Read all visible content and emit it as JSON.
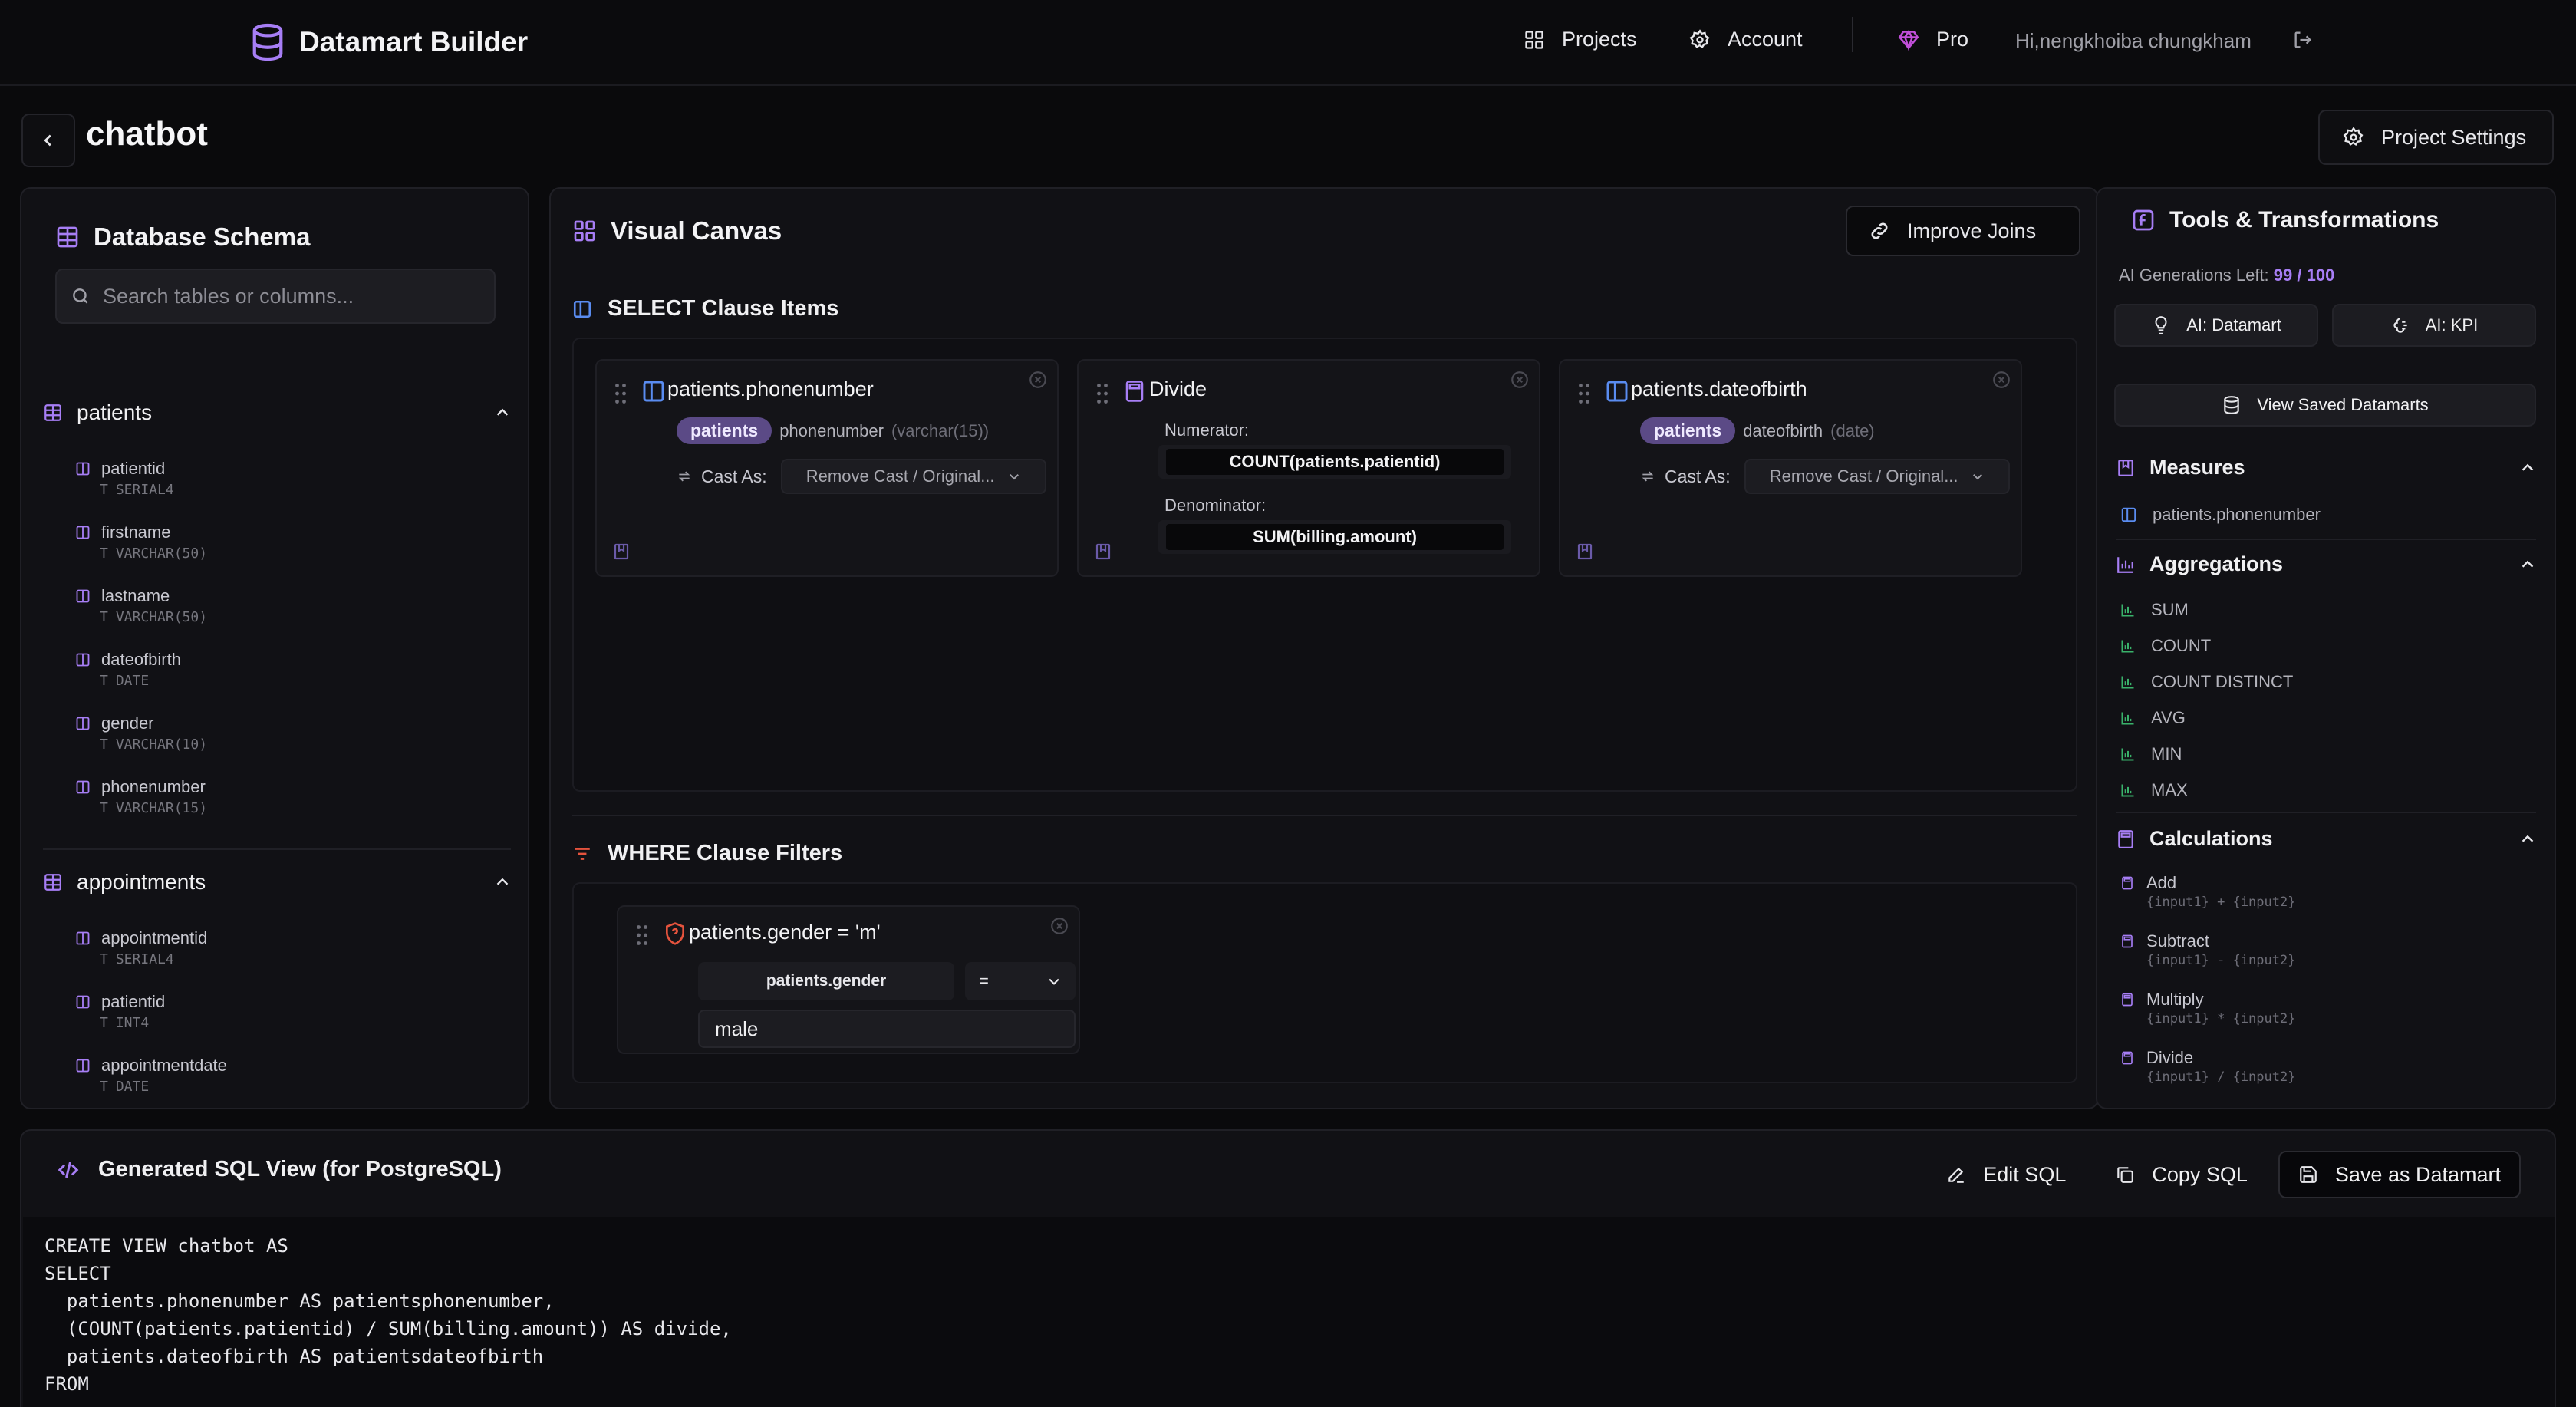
{
  "nav": {
    "brand": "Datamart Builder",
    "projects": "Projects",
    "account": "Account",
    "pro": "Pro",
    "greeting": "Hi,nengkhoiba chungkham"
  },
  "project": {
    "title": "chatbot",
    "settings_label": "Project Settings"
  },
  "schema": {
    "title": "Database Schema",
    "search_placeholder": "Search tables or columns...",
    "tables": [
      {
        "name": "patients",
        "columns": [
          {
            "name": "patientid",
            "type": "SERIAL4"
          },
          {
            "name": "firstname",
            "type": "VARCHAR(50)"
          },
          {
            "name": "lastname",
            "type": "VARCHAR(50)"
          },
          {
            "name": "dateofbirth",
            "type": "DATE"
          },
          {
            "name": "gender",
            "type": "VARCHAR(10)"
          },
          {
            "name": "phonenumber",
            "type": "VARCHAR(15)"
          }
        ]
      },
      {
        "name": "appointments",
        "columns": [
          {
            "name": "appointmentid",
            "type": "SERIAL4"
          },
          {
            "name": "patientid",
            "type": "INT4"
          },
          {
            "name": "appointmentdate",
            "type": "DATE"
          }
        ]
      }
    ]
  },
  "canvas": {
    "title": "Visual Canvas",
    "improve_label": "Improve Joins",
    "select_title": "SELECT Clause Items",
    "where_title": "WHERE Clause Filters",
    "cards": [
      {
        "title": "patients.phonenumber",
        "table": "patients",
        "column": "phonenumber",
        "type": "(varchar(15))",
        "cast_label": "Cast As:",
        "cast_value": "Remove Cast / Original..."
      },
      {
        "title": "Divide",
        "numerator_label": "Numerator:",
        "numerator": "COUNT(patients.patientid)",
        "denominator_label": "Denominator:",
        "denominator": "SUM(billing.amount)"
      },
      {
        "title": "patients.dateofbirth",
        "table": "patients",
        "column": "dateofbirth",
        "type": "(date)",
        "cast_label": "Cast As:",
        "cast_value": "Remove Cast / Original..."
      }
    ],
    "filter": {
      "title": "patients.gender = 'm'",
      "field": "patients.gender",
      "operator": "=",
      "value": "male"
    }
  },
  "tools": {
    "title": "Tools & Transformations",
    "ai_left_label": "AI Generations Left:",
    "ai_left_value": "99 / 100",
    "ai_datamart": "AI: Datamart",
    "ai_kpi": "AI: KPI",
    "view_saved": "View Saved Datamarts",
    "measures_title": "Measures",
    "measures": [
      "patients.phonenumber"
    ],
    "aggregations_title": "Aggregations",
    "aggregations": [
      "SUM",
      "COUNT",
      "COUNT DISTINCT",
      "AVG",
      "MIN",
      "MAX"
    ],
    "calculations_title": "Calculations",
    "calculations": [
      {
        "name": "Add",
        "formula": "{input1} + {input2}"
      },
      {
        "name": "Subtract",
        "formula": "{input1} - {input2}"
      },
      {
        "name": "Multiply",
        "formula": "{input1} * {input2}"
      },
      {
        "name": "Divide",
        "formula": "{input1} / {input2}"
      }
    ]
  },
  "sql": {
    "title": "Generated SQL View (for PostgreSQL)",
    "edit_label": "Edit SQL",
    "copy_label": "Copy SQL",
    "save_label": "Save as Datamart",
    "lines": [
      "CREATE VIEW chatbot AS",
      "SELECT",
      "  patients.phonenumber AS patientsphonenumber,",
      "  (COUNT(patients.patientid) / SUM(billing.amount)) AS divide,",
      "  patients.dateofbirth AS patientsdateofbirth",
      "FROM"
    ]
  },
  "colors": {
    "accent": "#a77ef5",
    "chip": "#5b4a86",
    "blue_icon": "#5a8cf0",
    "green_icon": "#39b26a",
    "red_icon": "#e5533d"
  }
}
